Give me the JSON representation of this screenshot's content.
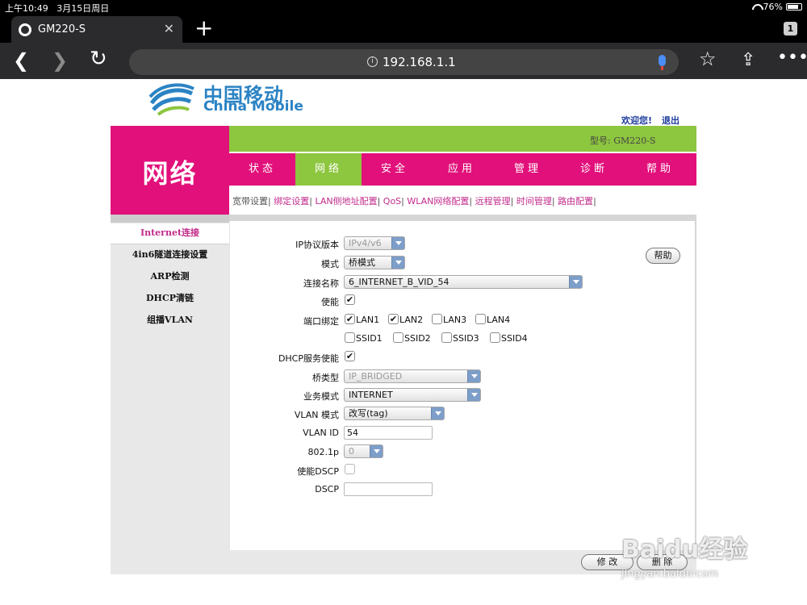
{
  "status_bar": {
    "time": "上午10:49",
    "date": "3月15日周日",
    "battery": "76%"
  },
  "browser": {
    "tab_title": "GM220-S",
    "tab_count": "1",
    "url": "192.168.1.1"
  },
  "brand": {
    "cn": "中国移动",
    "en": "China Mobile"
  },
  "header": {
    "welcome": "欢迎您!",
    "logout": "退出",
    "model": "型号: GM220-S",
    "section_title": "网络"
  },
  "nav": {
    "items": [
      "状态",
      "网络",
      "安全",
      "应用",
      "管理",
      "诊断",
      "帮助"
    ],
    "active": "网络"
  },
  "subnav": [
    "宽带设置",
    "绑定设置",
    "LAN侧地址配置",
    "QoS",
    "WLAN网络配置",
    "远程管理",
    "时间管理",
    "路由配置"
  ],
  "sidebar": {
    "items": [
      "Internet连接",
      "4in6隧道连接设置",
      "ARP检测",
      "DHCP清链",
      "组播VLAN"
    ],
    "active": "Internet连接"
  },
  "form": {
    "ip_version_label": "IP协议版本",
    "ip_version_value": "IPv4/v6",
    "mode_label": "模式",
    "mode_value": "桥模式",
    "conn_name_label": "连接名称",
    "conn_name_value": "6_INTERNET_B_VID_54",
    "enable_label": "使能",
    "port_bind_label": "端口绑定",
    "ports": [
      "LAN1",
      "LAN2",
      "LAN3",
      "LAN4",
      "SSID1",
      "SSID2",
      "SSID3",
      "SSID4"
    ],
    "dhcp_label": "DHCP服务使能",
    "bridge_type_label": "桥类型",
    "bridge_type_value": "IP_BRIDGED",
    "service_mode_label": "业务模式",
    "service_mode_value": "INTERNET",
    "vlan_mode_label": "VLAN 模式",
    "vlan_mode_value": "改写(tag)",
    "vlan_id_label": "VLAN ID",
    "vlan_id_value": "54",
    "p8021_label": "802.1p",
    "p8021_value": "0",
    "dscp_enable_label": "使能DSCP",
    "dscp_label": "DSCP",
    "dscp_value": "",
    "help_button": "帮助",
    "modify_button": "修 改",
    "delete_button": "删 除"
  },
  "watermark": {
    "brand": "Baidu经验",
    "url": "jingyan.baidu.com"
  }
}
